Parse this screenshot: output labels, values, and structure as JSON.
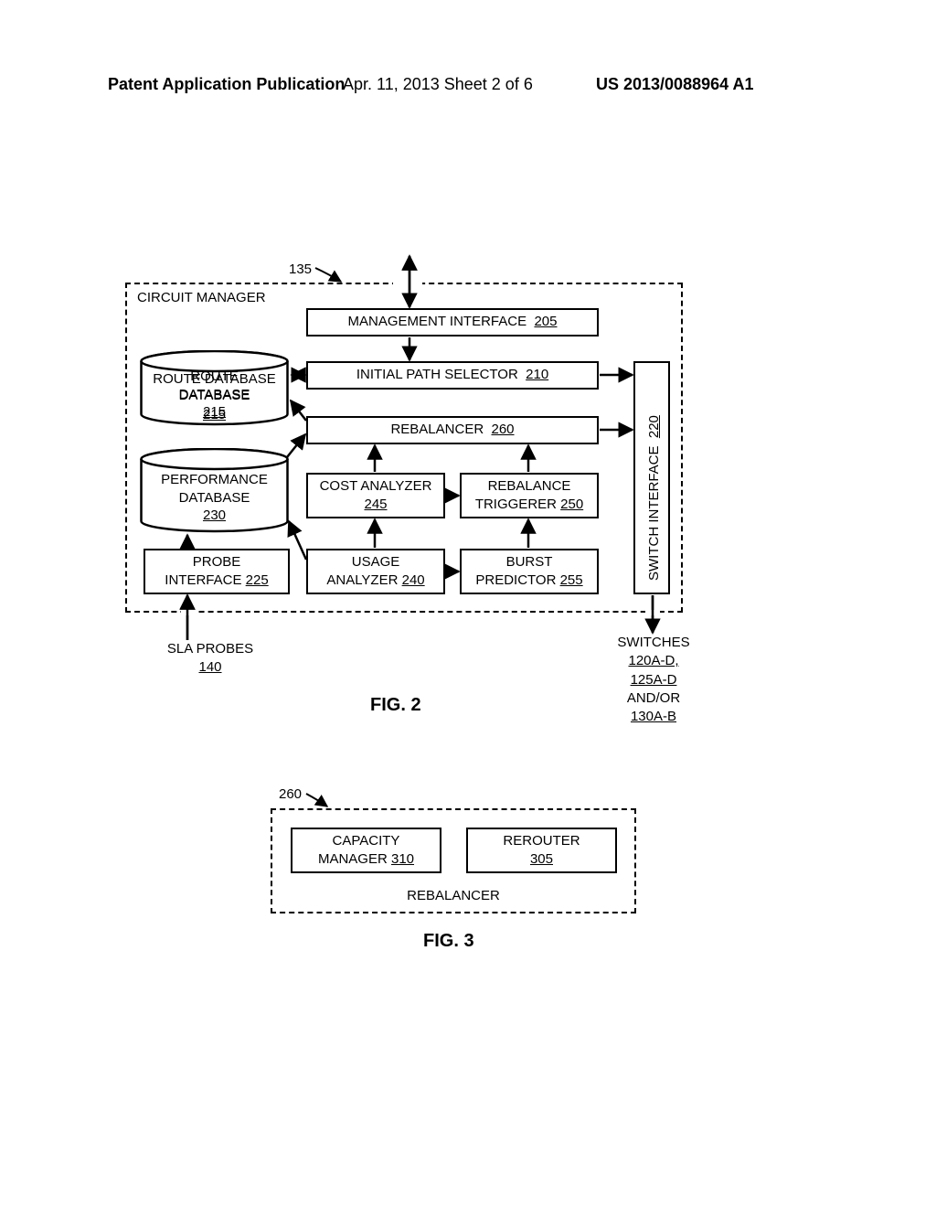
{
  "header": {
    "left": "Patent Application Publication",
    "mid": "Apr. 11, 2013  Sheet 2 of 6",
    "right": "US 2013/0088964 A1"
  },
  "fig2": {
    "ref135": "135",
    "title": "CIRCUIT MANAGER",
    "mgmt": "MANAGEMENT INTERFACE",
    "mgmt_no": "205",
    "ips": "INITIAL PATH SELECTOR",
    "ips_no": "210",
    "rebal": "REBALANCER",
    "rebal_no": "260",
    "cost": "COST ANALYZER",
    "cost_no": "245",
    "trig": "REBALANCE TRIGGERER",
    "trig_no": "250",
    "usage": "USAGE ANALYZER",
    "usage_no": "240",
    "burst": "BURST PREDICTOR",
    "burst_no": "255",
    "probeif": "PROBE INTERFACE",
    "probeif_no": "225",
    "swif": "SWITCH INTERFACE",
    "swif_no": "220",
    "routedb": "ROUTE DATABASE",
    "routedb_no": "215",
    "perfdb": "PERFORMANCE DATABASE",
    "perfdb_no": "230",
    "sla": "SLA PROBES",
    "sla_no": "140",
    "switches_l1": "SWITCHES",
    "switches_l2": "120A-D,",
    "switches_l3": "125A-D",
    "switches_l4": "AND/OR",
    "switches_l5": "130A-B",
    "caption": "FIG. 2"
  },
  "fig3": {
    "ref260": "260",
    "cap": "CAPACITY MANAGER",
    "cap_no": "310",
    "rerouter": "REROUTER",
    "rerouter_no": "305",
    "title": "REBALANCER",
    "caption": "FIG. 3"
  }
}
